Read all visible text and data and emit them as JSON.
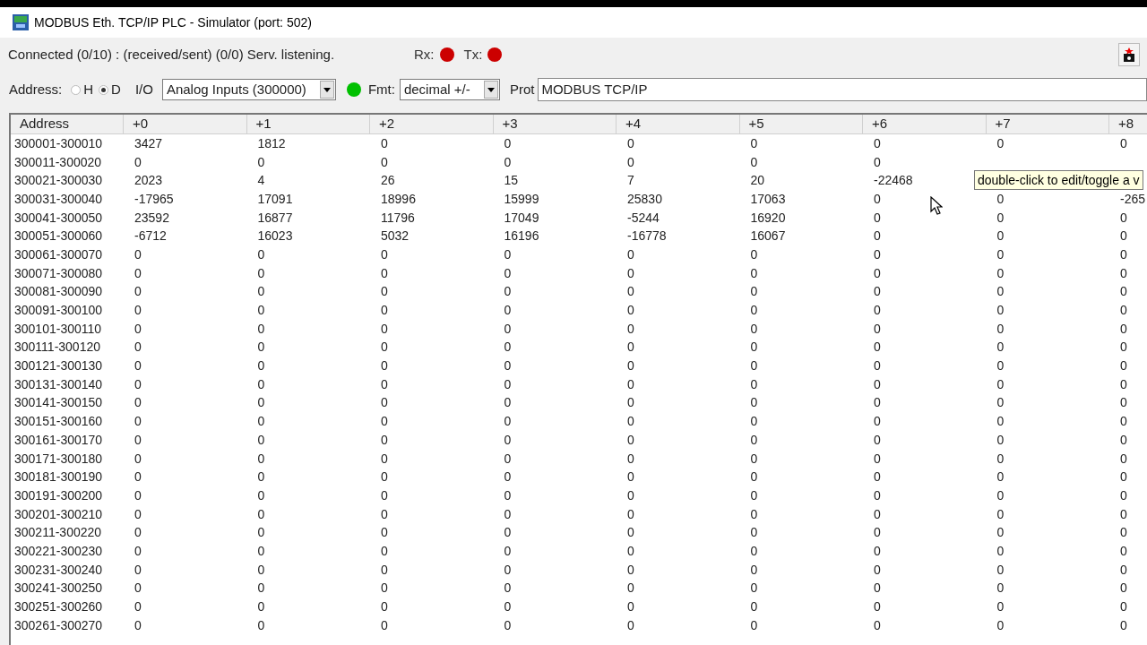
{
  "window": {
    "title": "MODBUS Eth. TCP/IP PLC - Simulator (port: 502)"
  },
  "status": {
    "text": "Connected (0/10) : (received/sent) (0/0) Serv. listening.",
    "indicators": [
      {
        "label": "Rx:",
        "color": "#cc0000"
      },
      {
        "label": "Tx:",
        "color": "#cc0000"
      }
    ]
  },
  "address": {
    "label": "Address:",
    "options": [
      {
        "label": "H",
        "selected": false
      },
      {
        "label": "D",
        "selected": true
      }
    ]
  },
  "io": {
    "label": "I/O",
    "value": "Analog Inputs (300000)",
    "led": {
      "color": "#00c000"
    }
  },
  "fmt": {
    "label": "Fmt:",
    "value": "decimal +/-"
  },
  "prot": {
    "label": "Prot",
    "value": "MODBUS TCP/IP"
  },
  "table": {
    "columns": [
      "Address",
      "+0",
      "+1",
      "+2",
      "+3",
      "+4",
      "+5",
      "+6",
      "+7",
      "+8"
    ],
    "rows": [
      [
        "300001-300010",
        "3427",
        "1812",
        "0",
        "0",
        "0",
        "0",
        "0",
        "0",
        "0"
      ],
      [
        "300011-300020",
        "0",
        "0",
        "0",
        "0",
        "0",
        "0",
        "0",
        null,
        null
      ],
      [
        "300021-300030",
        "2023",
        "4",
        "26",
        "15",
        "7",
        "20",
        "-22468",
        null,
        null
      ],
      [
        "300031-300040",
        "-17965",
        "17091",
        "18996",
        "15999",
        "25830",
        "17063",
        "0",
        "0",
        "-265"
      ],
      [
        "300041-300050",
        "23592",
        "16877",
        "11796",
        "17049",
        "-5244",
        "16920",
        "0",
        "0",
        "0"
      ],
      [
        "300051-300060",
        "-6712",
        "16023",
        "5032",
        "16196",
        "-16778",
        "16067",
        "0",
        "0",
        "0"
      ],
      [
        "300061-300070",
        "0",
        "0",
        "0",
        "0",
        "0",
        "0",
        "0",
        "0",
        "0"
      ],
      [
        "300071-300080",
        "0",
        "0",
        "0",
        "0",
        "0",
        "0",
        "0",
        "0",
        "0"
      ],
      [
        "300081-300090",
        "0",
        "0",
        "0",
        "0",
        "0",
        "0",
        "0",
        "0",
        "0"
      ],
      [
        "300091-300100",
        "0",
        "0",
        "0",
        "0",
        "0",
        "0",
        "0",
        "0",
        "0"
      ],
      [
        "300101-300110",
        "0",
        "0",
        "0",
        "0",
        "0",
        "0",
        "0",
        "0",
        "0"
      ],
      [
        "300111-300120",
        "0",
        "0",
        "0",
        "0",
        "0",
        "0",
        "0",
        "0",
        "0"
      ],
      [
        "300121-300130",
        "0",
        "0",
        "0",
        "0",
        "0",
        "0",
        "0",
        "0",
        "0"
      ],
      [
        "300131-300140",
        "0",
        "0",
        "0",
        "0",
        "0",
        "0",
        "0",
        "0",
        "0"
      ],
      [
        "300141-300150",
        "0",
        "0",
        "0",
        "0",
        "0",
        "0",
        "0",
        "0",
        "0"
      ],
      [
        "300151-300160",
        "0",
        "0",
        "0",
        "0",
        "0",
        "0",
        "0",
        "0",
        "0"
      ],
      [
        "300161-300170",
        "0",
        "0",
        "0",
        "0",
        "0",
        "0",
        "0",
        "0",
        "0"
      ],
      [
        "300171-300180",
        "0",
        "0",
        "0",
        "0",
        "0",
        "0",
        "0",
        "0",
        "0"
      ],
      [
        "300181-300190",
        "0",
        "0",
        "0",
        "0",
        "0",
        "0",
        "0",
        "0",
        "0"
      ],
      [
        "300191-300200",
        "0",
        "0",
        "0",
        "0",
        "0",
        "0",
        "0",
        "0",
        "0"
      ],
      [
        "300201-300210",
        "0",
        "0",
        "0",
        "0",
        "0",
        "0",
        "0",
        "0",
        "0"
      ],
      [
        "300211-300220",
        "0",
        "0",
        "0",
        "0",
        "0",
        "0",
        "0",
        "0",
        "0"
      ],
      [
        "300221-300230",
        "0",
        "0",
        "0",
        "0",
        "0",
        "0",
        "0",
        "0",
        "0"
      ],
      [
        "300231-300240",
        "0",
        "0",
        "0",
        "0",
        "0",
        "0",
        "0",
        "0",
        "0"
      ],
      [
        "300241-300250",
        "0",
        "0",
        "0",
        "0",
        "0",
        "0",
        "0",
        "0",
        "0"
      ],
      [
        "300251-300260",
        "0",
        "0",
        "0",
        "0",
        "0",
        "0",
        "0",
        "0",
        "0"
      ],
      [
        "300261-300270",
        "0",
        "0",
        "0",
        "0",
        "0",
        "0",
        "0",
        "0",
        "0"
      ]
    ]
  },
  "tooltip": {
    "text": "double-click to edit/toggle a v"
  }
}
